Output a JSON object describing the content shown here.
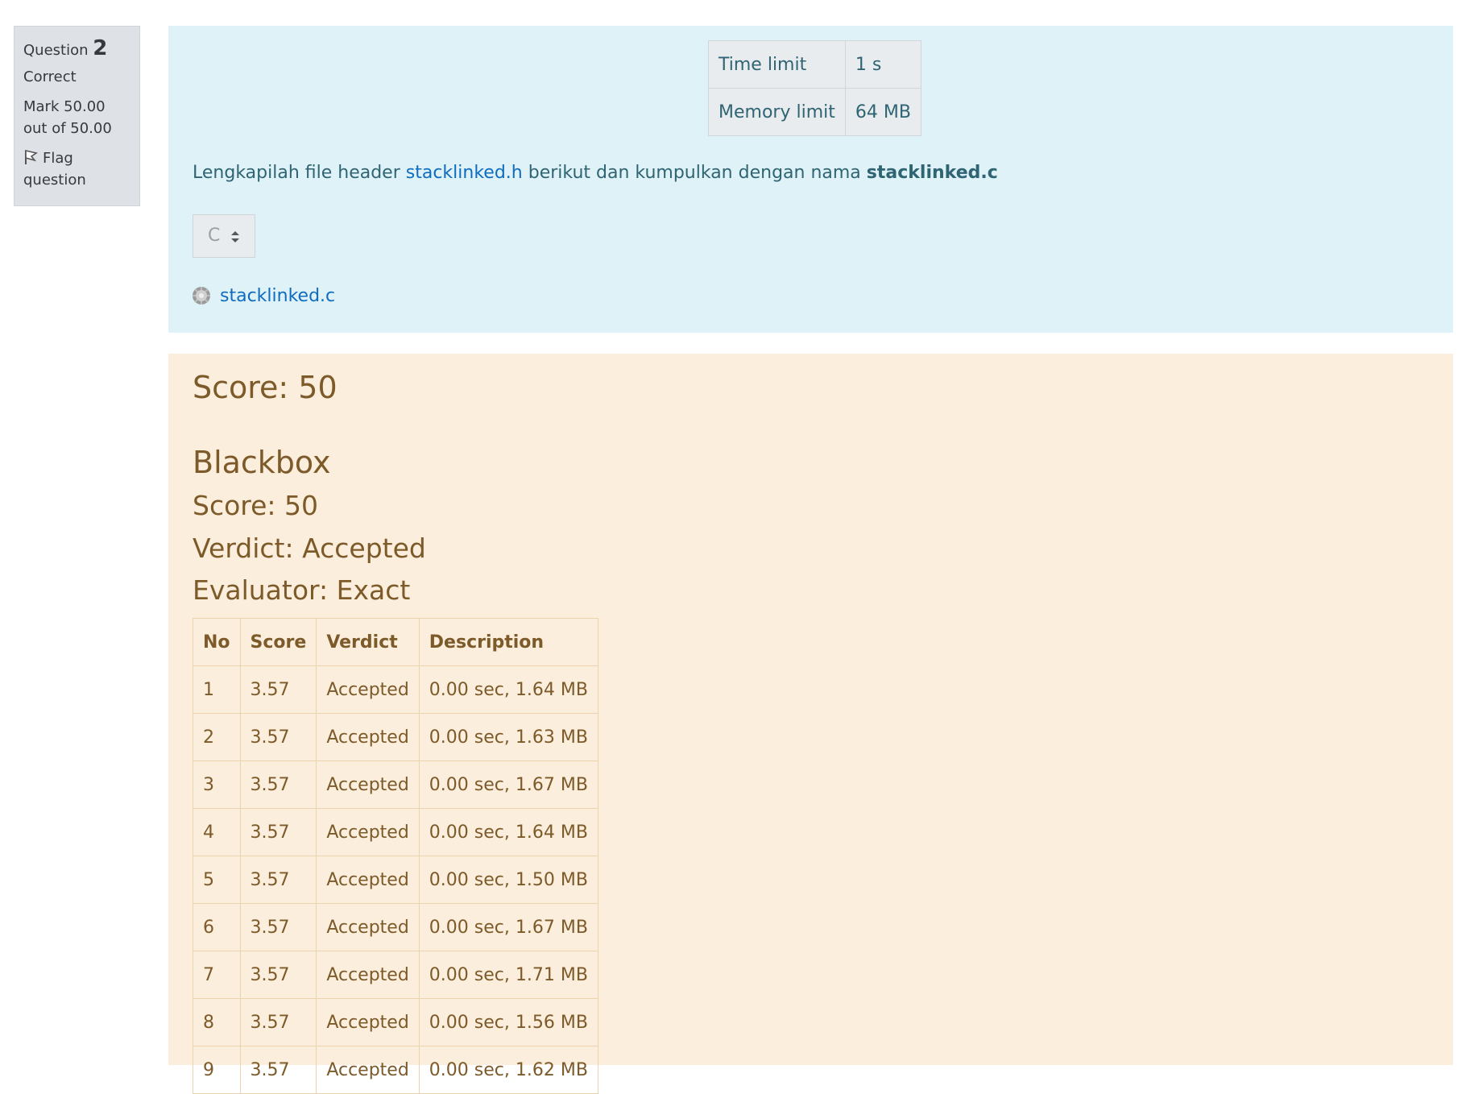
{
  "question_info": {
    "label": "Question",
    "number": "2",
    "state": "Correct",
    "grade": "Mark 50.00 out of 50.00",
    "flag_label": "Flag question"
  },
  "formulation": {
    "limits": {
      "time_label": "Time limit",
      "time_value": "1 s",
      "memory_label": "Memory limit",
      "memory_value": "64 MB"
    },
    "prompt_before": "Lengkapilah file header ",
    "prompt_link": "stacklinked.h",
    "prompt_middle": " berikut dan kumpulkan dengan nama ",
    "prompt_bold": "stacklinked.c",
    "language": "C",
    "file_name": "stacklinked.c"
  },
  "feedback": {
    "score": "Score: 50",
    "blackbox": {
      "title": "Blackbox",
      "score": "Score: 50",
      "verdict": "Verdict: Accepted",
      "evaluator": "Evaluator: Exact"
    },
    "table": {
      "headers": [
        "No",
        "Score",
        "Verdict",
        "Description"
      ],
      "rows": [
        [
          "1",
          "3.57",
          "Accepted",
          "0.00 sec, 1.64 MB"
        ],
        [
          "2",
          "3.57",
          "Accepted",
          "0.00 sec, 1.63 MB"
        ],
        [
          "3",
          "3.57",
          "Accepted",
          "0.00 sec, 1.67 MB"
        ],
        [
          "4",
          "3.57",
          "Accepted",
          "0.00 sec, 1.64 MB"
        ],
        [
          "5",
          "3.57",
          "Accepted",
          "0.00 sec, 1.50 MB"
        ],
        [
          "6",
          "3.57",
          "Accepted",
          "0.00 sec, 1.67 MB"
        ],
        [
          "7",
          "3.57",
          "Accepted",
          "0.00 sec, 1.71 MB"
        ],
        [
          "8",
          "3.57",
          "Accepted",
          "0.00 sec, 1.56 MB"
        ],
        [
          "9",
          "3.57",
          "Accepted",
          "0.00 sec, 1.62 MB"
        ]
      ]
    }
  },
  "colors": {
    "info_bg": "#dee2e6",
    "formulation_bg": "#def2f8",
    "feedback_bg": "#fbeedc",
    "link": "#0f6cbf"
  }
}
